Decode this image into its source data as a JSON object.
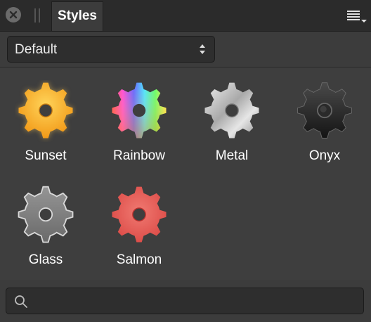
{
  "panel": {
    "tab_label": "Styles",
    "close_icon": "close-icon",
    "menu_icon": "panel-menu-icon"
  },
  "category": {
    "selected": "Default",
    "icon": "stepper-arrows-icon"
  },
  "styles": [
    {
      "label": "Sunset",
      "color": "#f5a623"
    },
    {
      "label": "Rainbow",
      "color": "rainbow"
    },
    {
      "label": "Metal",
      "color": "#c8c8c8"
    },
    {
      "label": "Onyx",
      "color": "#2a2a2a"
    },
    {
      "label": "Glass",
      "color": "#7a7a7a"
    },
    {
      "label": "Salmon",
      "color": "#e85c57"
    }
  ],
  "search": {
    "placeholder": "",
    "value": "",
    "icon": "search-icon"
  }
}
